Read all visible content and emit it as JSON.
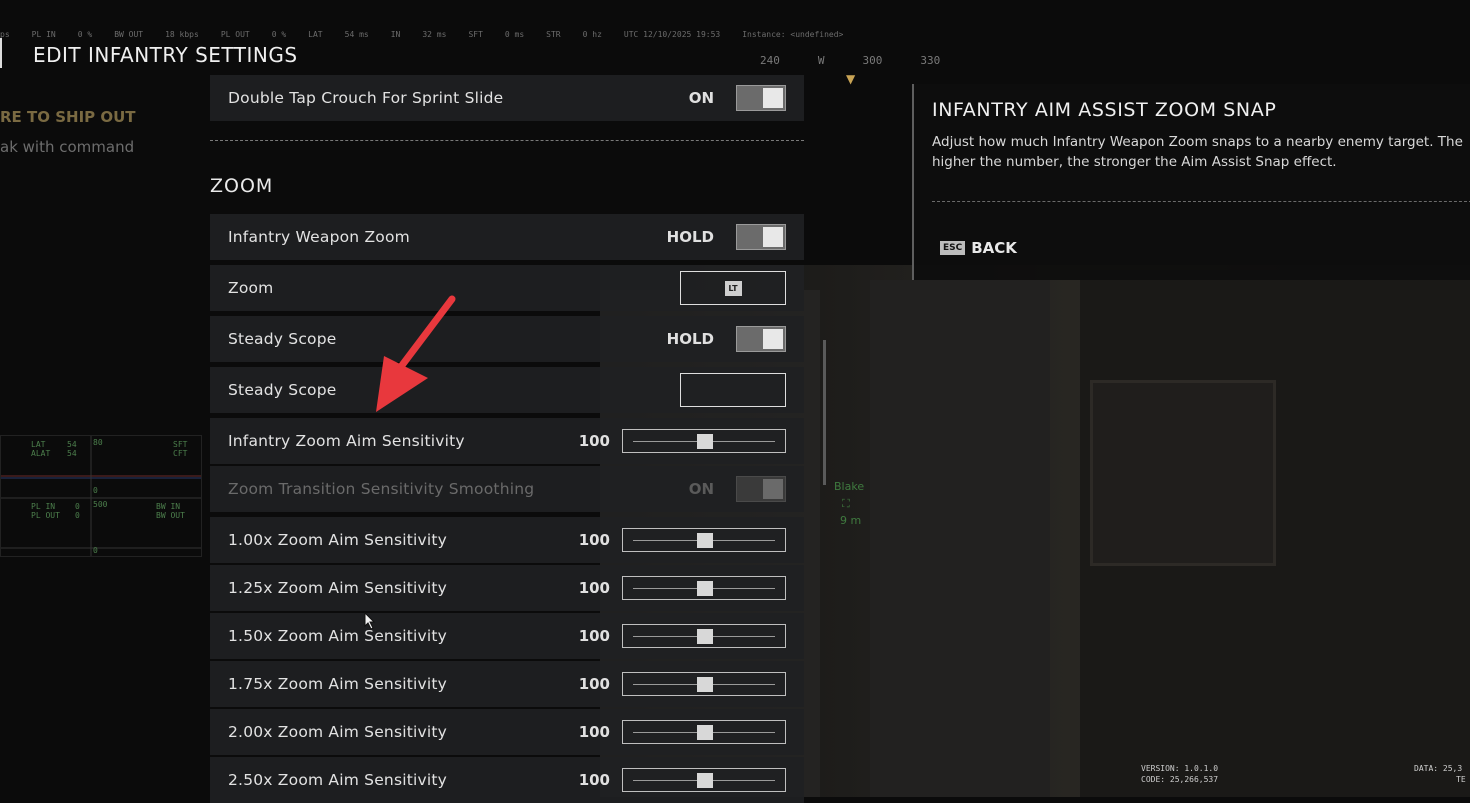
{
  "topbar": {
    "items": [
      "ps",
      "PL IN",
      "0 %",
      "BW OUT",
      "18 kbps",
      "PL OUT",
      "0 %",
      "LAT",
      "54 ms",
      "IN",
      "32 ms",
      "SFT",
      "0 ms",
      "STR",
      "0 hz",
      "UTC 12/10/2025 19:53",
      "Instance: <undefined>"
    ]
  },
  "compass": {
    "ticks": [
      "240",
      "W",
      "300",
      "330"
    ]
  },
  "header": {
    "title": "EDIT INFANTRY SETTINGS"
  },
  "side_status": {
    "line1": "RE TO SHIP OUT",
    "line2": "ak with command"
  },
  "netgraph": {
    "labels": [
      "LAT",
      "54",
      "ALAT",
      "54",
      "SFT",
      "CFT",
      "PL IN",
      "0",
      "PL OUT",
      "0",
      "BW IN",
      "BW OUT",
      "80",
      "0",
      "500",
      "0"
    ]
  },
  "settings": {
    "top_row": {
      "label": "Double Tap Crouch For Sprint Slide",
      "value": "ON"
    },
    "section_title": "ZOOM",
    "rows": [
      {
        "label": "Infantry Weapon Zoom",
        "type": "toggle",
        "value": "HOLD"
      },
      {
        "label": "Zoom",
        "type": "key",
        "key": "LT"
      },
      {
        "label": "Steady Scope",
        "type": "toggle",
        "value": "HOLD"
      },
      {
        "label": "Steady Scope",
        "type": "key",
        "key": ""
      },
      {
        "label": "Infantry Zoom Aim Sensitivity",
        "type": "slider",
        "value": "100",
        "level": 0.5
      },
      {
        "label": "Zoom Transition Sensitivity Smoothing",
        "type": "toggle",
        "value": "ON",
        "disabled": true
      },
      {
        "label": "1.00x Zoom Aim Sensitivity",
        "type": "slider",
        "value": "100",
        "level": 0.5
      },
      {
        "label": "1.25x Zoom Aim Sensitivity",
        "type": "slider",
        "value": "100",
        "level": 0.5
      },
      {
        "label": "1.50x Zoom Aim Sensitivity",
        "type": "slider",
        "value": "100",
        "level": 0.5
      },
      {
        "label": "1.75x Zoom Aim Sensitivity",
        "type": "slider",
        "value": "100",
        "level": 0.5
      },
      {
        "label": "2.00x Zoom Aim Sensitivity",
        "type": "slider",
        "value": "100",
        "level": 0.5
      },
      {
        "label": "2.50x Zoom Aim Sensitivity",
        "type": "slider",
        "value": "100",
        "level": 0.5
      }
    ]
  },
  "info": {
    "title": "INFANTRY AIM ASSIST ZOOM SNAP",
    "description": "Adjust how much Infantry Weapon Zoom snaps to a nearby enemy target. The higher the number, the stronger the Aim Assist Snap effect.",
    "back_key": "ESC",
    "back_label": "BACK"
  },
  "player_tag": {
    "name": "Blake",
    "distance": "9 m"
  },
  "footer": {
    "version": "VERSION: 1.0.1.0",
    "code": "CODE: 25,266,537",
    "data": "DATA: 25,3",
    "te": "TE"
  },
  "colors": {
    "accent_arrow": "#e8383d",
    "status_gold": "#7a6a42"
  }
}
